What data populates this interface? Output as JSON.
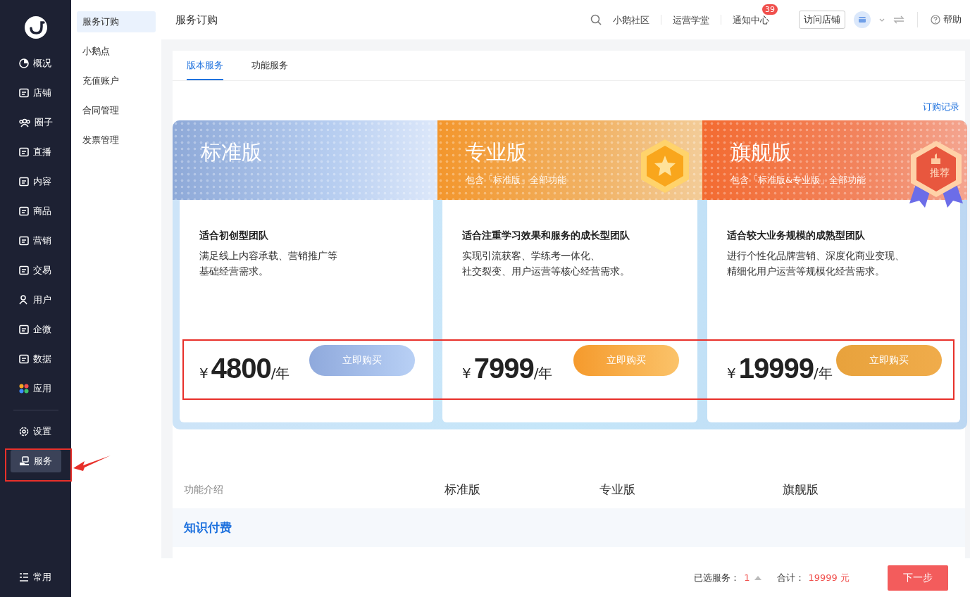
{
  "sidebar": {
    "items": [
      {
        "label": "概况",
        "selected": false
      },
      {
        "label": "店铺",
        "selected": false
      },
      {
        "label": "圈子",
        "selected": false
      },
      {
        "label": "直播",
        "selected": false
      },
      {
        "label": "内容",
        "selected": false
      },
      {
        "label": "商品",
        "selected": false
      },
      {
        "label": "营销",
        "selected": false
      },
      {
        "label": "交易",
        "selected": false
      },
      {
        "label": "用户",
        "selected": false
      },
      {
        "label": "企微",
        "selected": false
      },
      {
        "label": "数据",
        "selected": false
      },
      {
        "label": "应用",
        "selected": false
      }
    ],
    "bottom_items": [
      {
        "label": "设置",
        "selected": false
      },
      {
        "label": "服务",
        "selected": true
      }
    ],
    "footer": "常用"
  },
  "subnav": [
    {
      "label": "服务订购",
      "selected": true
    },
    {
      "label": "小鹅点",
      "selected": false
    },
    {
      "label": "充值账户",
      "selected": false
    },
    {
      "label": "合同管理",
      "selected": false
    },
    {
      "label": "发票管理",
      "selected": false
    }
  ],
  "header": {
    "title": "服务订购",
    "links": [
      "小鹅社区",
      "运营学堂",
      "通知中心"
    ],
    "notification_badge": "39",
    "visit_button": "访问店铺",
    "help": "帮助"
  },
  "tabs": [
    {
      "label": "版本服务",
      "selected": true
    },
    {
      "label": "功能服务",
      "selected": false
    }
  ],
  "order_history_link": "订购记录",
  "plans": [
    {
      "kind": "standard",
      "name": "标准版",
      "audience": "适合初创型团队",
      "description": [
        "满足线上内容承载、营销推广等",
        "基础经营需求。"
      ],
      "currency": "¥",
      "price": "4800",
      "unit": "/年",
      "button": "立即购买"
    },
    {
      "kind": "pro",
      "name": "专业版",
      "includes": "包含「标准版」全部功能",
      "audience": "适合注重学习效果和服务的成长型团队",
      "description": [
        "实现引流获客、学练考一体化、",
        "社交裂变、用户运营等核心经营需求。"
      ],
      "currency": "¥",
      "price": "7999",
      "unit": "/年",
      "button": "立即购买"
    },
    {
      "kind": "flagship",
      "name": "旗舰版",
      "includes": "包含「标准版&专业版」全部功能",
      "badge": "推荐",
      "audience": "适合较大业务规模的成熟型团队",
      "description": [
        "进行个性化品牌营销、深度化商业变现、",
        "精细化用户运营等规模化经营需求。"
      ],
      "currency": "¥",
      "price": "19999",
      "unit": "/年",
      "button": "立即购买"
    }
  ],
  "comparison": {
    "columns": [
      "功能介绍",
      "标准版",
      "专业版",
      "旗舰版"
    ],
    "section": "知识付费"
  },
  "footer_bar": {
    "selected_label": "已选服务：",
    "selected_count": "1",
    "total_label": "合计：",
    "total": "19999 元",
    "next_button": "下一步"
  }
}
